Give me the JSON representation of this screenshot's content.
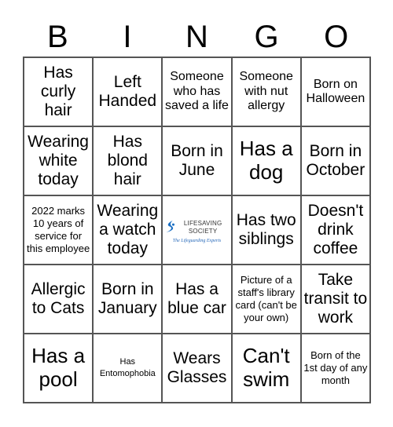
{
  "header": [
    "B",
    "I",
    "N",
    "G",
    "O"
  ],
  "cells": [
    {
      "text": "Has curly hair",
      "size": "s2"
    },
    {
      "text": "Left Handed",
      "size": "s2"
    },
    {
      "text": "Someone who has saved a life",
      "size": "s3"
    },
    {
      "text": "Someone with nut allergy",
      "size": "s3"
    },
    {
      "text": "Born on Halloween",
      "size": "s3"
    },
    {
      "text": "Wearing white today",
      "size": "s2"
    },
    {
      "text": "Has blond hair",
      "size": "s2"
    },
    {
      "text": "Born in June",
      "size": "s2"
    },
    {
      "text": "Has a dog",
      "size": "s1"
    },
    {
      "text": "Born in October",
      "size": "s2"
    },
    {
      "text": "2022 marks 10 years of service for this employee",
      "size": "s4"
    },
    {
      "text": "Wearing a watch today",
      "size": "s2"
    },
    {
      "free": true,
      "logo_title": "LIFESAVING SOCIETY",
      "logo_tagline": "The Lifeguarding Experts",
      "logo_color": "#1a6fc4"
    },
    {
      "text": "Has two siblings",
      "size": "s2"
    },
    {
      "text": "Doesn't drink coffee",
      "size": "s2"
    },
    {
      "text": "Allergic to Cats",
      "size": "s2"
    },
    {
      "text": "Born in January",
      "size": "s2"
    },
    {
      "text": "Has a blue car",
      "size": "s2"
    },
    {
      "text": "Picture of a staff's library card (can't be your own)",
      "size": "s4"
    },
    {
      "text": "Take transit to work",
      "size": "s2"
    },
    {
      "text": "Has a pool",
      "size": "s1"
    },
    {
      "text": "Has Entomophobia",
      "size": "s5"
    },
    {
      "text": "Wears Glasses",
      "size": "s2"
    },
    {
      "text": "Can't swim",
      "size": "s1"
    },
    {
      "text": "Born of the 1st day of any month",
      "size": "s4"
    }
  ]
}
